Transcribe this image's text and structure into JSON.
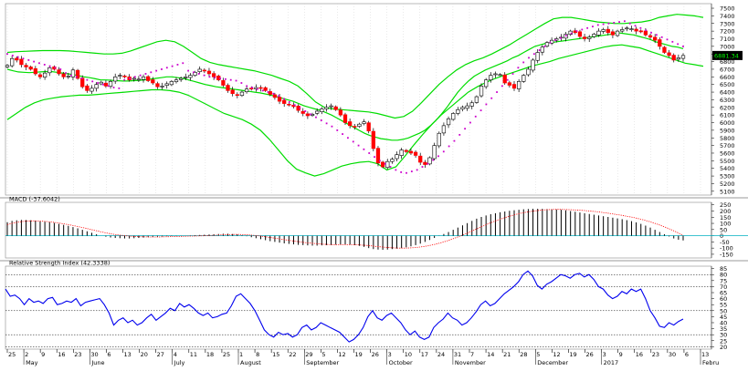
{
  "chart_data": [
    {
      "panel": "price",
      "type": "candlestick",
      "overlays": [
        "bollinger-bands",
        "parabolic-sar"
      ],
      "y_ticks": [
        5100,
        5200,
        5300,
        5400,
        5500,
        5600,
        5700,
        5800,
        5900,
        6000,
        6100,
        6200,
        6300,
        6400,
        6500,
        6600,
        6700,
        6800,
        6900,
        7000,
        7100,
        7200,
        7300,
        7400,
        7500
      ],
      "ylim": [
        5050,
        7560
      ],
      "last_price_label": "6881.34",
      "grid": "vertical-dotted",
      "colors": {
        "up": "#ffffff",
        "down": "#ff0000",
        "wick": "#000000",
        "bands": "#00dd00",
        "sar": "#cc00cc",
        "last_price_bg": "#000000",
        "last_price_fg": "#00ff00"
      },
      "close": [
        6750,
        6840,
        6820,
        6760,
        6730,
        6700,
        6640,
        6600,
        6650,
        6720,
        6700,
        6640,
        6600,
        6610,
        6690,
        6580,
        6470,
        6420,
        6450,
        6500,
        6530,
        6480,
        6540,
        6600,
        6620,
        6600,
        6560,
        6580,
        6570,
        6600,
        6550,
        6520,
        6470,
        6480,
        6510,
        6540,
        6560,
        6580,
        6600,
        6620,
        6660,
        6700,
        6680,
        6640,
        6600,
        6560,
        6490,
        6420,
        6380,
        6360,
        6400,
        6440,
        6450,
        6460,
        6450,
        6420,
        6370,
        6330,
        6280,
        6250,
        6230,
        6210,
        6160,
        6120,
        6090,
        6110,
        6150,
        6180,
        6200,
        6220,
        6170,
        6100,
        6000,
        5960,
        5950,
        5980,
        6010,
        5890,
        5660,
        5470,
        5420,
        5490,
        5520,
        5580,
        5640,
        5620,
        5600,
        5570,
        5480,
        5450,
        5540,
        5700,
        5860,
        5960,
        6050,
        6120,
        6170,
        6200,
        6220,
        6260,
        6340,
        6480,
        6560,
        6620,
        6640,
        6630,
        6520,
        6490,
        6450,
        6540,
        6620,
        6700,
        6820,
        6920,
        6990,
        7050,
        7080,
        7100,
        7120,
        7160,
        7200,
        7180,
        7130,
        7100,
        7120,
        7160,
        7200,
        7220,
        7180,
        7150,
        7200,
        7220,
        7240,
        7230,
        7200,
        7190,
        7150,
        7120,
        7080,
        7000,
        6920,
        6880,
        6820,
        6850,
        6880
      ],
      "bb_mid": [
        6700,
        6680,
        6665,
        6660,
        6655,
        6660,
        6665,
        6670,
        6670,
        6660,
        6650,
        6640,
        6630,
        6615,
        6600,
        6590,
        6575,
        6560,
        6560,
        6555,
        6550,
        6545,
        6545,
        6550,
        6555,
        6560,
        6570,
        6580,
        6590,
        6600,
        6600,
        6590,
        6580,
        6560,
        6540,
        6520,
        6500,
        6485,
        6470,
        6460,
        6450,
        6440,
        6430,
        6420,
        6410,
        6400,
        6390,
        6375,
        6360,
        6340,
        6320,
        6300,
        6280,
        6250,
        6220,
        6200,
        6180,
        6160,
        6130,
        6100,
        6060,
        6020,
        5980,
        5940,
        5900,
        5860,
        5830,
        5810,
        5790,
        5780,
        5770,
        5770,
        5780,
        5800,
        5830,
        5860,
        5900,
        5960,
        6030,
        6110,
        6200,
        6300,
        6400,
        6480,
        6550,
        6610,
        6650,
        6690,
        6720,
        6750,
        6780,
        6810,
        6850,
        6880,
        6920,
        6960,
        7000,
        7020,
        7040,
        7050,
        7060,
        7070,
        7080,
        7090,
        7100,
        7110,
        7120,
        7130,
        7140,
        7150,
        7160,
        7180,
        7170,
        7160,
        7150,
        7130,
        7110,
        7090,
        7060,
        7040,
        7020,
        7000,
        6990,
        6970
      ],
      "bb_upper": [
        6920,
        6930,
        6935,
        6940,
        6945,
        6945,
        6945,
        6940,
        6930,
        6920,
        6910,
        6900,
        6900,
        6910,
        6940,
        6980,
        7020,
        7060,
        7080,
        7060,
        7000,
        6920,
        6840,
        6790,
        6760,
        6740,
        6720,
        6700,
        6680,
        6650,
        6620,
        6580,
        6540,
        6480,
        6380,
        6270,
        6200,
        6180,
        6170,
        6160,
        6150,
        6140,
        6120,
        6090,
        6060,
        6080,
        6150,
        6260,
        6380,
        6500,
        6600,
        6690,
        6760,
        6810,
        6850,
        6900,
        6960,
        7020,
        7090,
        7160,
        7230,
        7300,
        7360,
        7380,
        7380,
        7360,
        7340,
        7320,
        7310,
        7300,
        7300,
        7310,
        7320,
        7340,
        7380,
        7400,
        7420,
        7410,
        7400,
        7380
      ],
      "bb_lower": [
        6040,
        6120,
        6200,
        6260,
        6300,
        6320,
        6340,
        6350,
        6360,
        6360,
        6370,
        6380,
        6390,
        6400,
        6410,
        6420,
        6430,
        6430,
        6420,
        6400,
        6360,
        6300,
        6240,
        6180,
        6120,
        6080,
        6040,
        5980,
        5900,
        5780,
        5640,
        5500,
        5390,
        5340,
        5300,
        5330,
        5380,
        5430,
        5460,
        5480,
        5490,
        5460,
        5380,
        5420,
        5560,
        5710,
        5850,
        5980,
        6100,
        6200,
        6300,
        6400,
        6470,
        6530,
        6580,
        6620,
        6660,
        6700,
        6740,
        6770,
        6800,
        6840,
        6870,
        6900,
        6930,
        6960,
        6990,
        7010,
        7020,
        7000,
        6980,
        6940,
        6900,
        6860,
        6820,
        6780,
        6760,
        6740
      ],
      "sar": [
        6900,
        6880,
        6860,
        6840,
        6820,
        6800,
        6780,
        6760,
        6740,
        6720,
        6700,
        6650,
        6620,
        6600,
        6580,
        6560,
        6540,
        6520,
        6500,
        6480,
        6460,
        6450,
        6560,
        6580,
        6600,
        6620,
        6640,
        6660,
        6680,
        6700,
        6720,
        6740,
        6760,
        6780,
        6680,
        6660,
        6640,
        6620,
        6600,
        6590,
        6580,
        6570,
        6560,
        6550,
        6520,
        6480,
        6460,
        6440,
        6420,
        6400,
        6380,
        6350,
        6310,
        6270,
        6230,
        6190,
        6150,
        6110,
        6070,
        6030,
        5990,
        5950,
        5900,
        5850,
        5800,
        5750,
        5700,
        5650,
        5600,
        5550,
        5500,
        5460,
        5420,
        5380,
        5350,
        5340,
        5360,
        5380,
        5420,
        5460,
        5510,
        5560,
        5620,
        5690,
        5760,
        5840,
        5920,
        6000,
        6080,
        6160,
        6240,
        6320,
        6400,
        6480,
        6560,
        6640,
        6720,
        6790,
        6850,
        6900,
        6950,
        7000,
        7050,
        7080,
        7110,
        7140,
        7170,
        7200,
        7220,
        7240,
        7260,
        7280,
        7290,
        7300,
        7310,
        7320,
        7330,
        7300,
        7270,
        7240,
        7210,
        7180,
        7150,
        7120,
        7090,
        7060,
        7030,
        7000
      ]
    },
    {
      "panel": "macd",
      "type": "histogram",
      "title": "MACD (-37.6042)",
      "y_ticks": [
        250,
        200,
        150,
        100,
        50,
        0,
        -50,
        -100,
        -150
      ],
      "ylim": [
        -180,
        270
      ],
      "colors": {
        "hist": "#000000",
        "signal": "#ff0000",
        "zero": "#00b0c0"
      },
      "histogram": [
        110,
        120,
        125,
        128,
        127,
        125,
        122,
        118,
        114,
        110,
        104,
        96,
        88,
        80,
        70,
        60,
        48,
        36,
        24,
        12,
        0,
        -8,
        -14,
        -18,
        -20,
        -22,
        -22,
        -20,
        -18,
        -15,
        -12,
        -10,
        -8,
        -6,
        -4,
        -3,
        -2,
        -1,
        0,
        2,
        4,
        6,
        8,
        10,
        12,
        14,
        16,
        16,
        14,
        10,
        4,
        -4,
        -12,
        -20,
        -28,
        -36,
        -44,
        -50,
        -56,
        -62,
        -66,
        -70,
        -74,
        -76,
        -78,
        -80,
        -80,
        -78,
        -76,
        -74,
        -72,
        -70,
        -70,
        -72,
        -76,
        -82,
        -90,
        -100,
        -108,
        -112,
        -114,
        -112,
        -108,
        -104,
        -100,
        -94,
        -86,
        -76,
        -64,
        -50,
        -34,
        -18,
        -2,
        14,
        30,
        48,
        66,
        84,
        102,
        120,
        138,
        152,
        164,
        174,
        182,
        190,
        196,
        202,
        206,
        210,
        214,
        216,
        218,
        218,
        218,
        216,
        214,
        212,
        210,
        206,
        200,
        194,
        188,
        182,
        176,
        170,
        164,
        158,
        152,
        146,
        140,
        134,
        126,
        118,
        108,
        96,
        82,
        66,
        48,
        30,
        12,
        -6,
        -22,
        -32,
        -38
      ],
      "signal": [
        90,
        100,
        108,
        114,
        118,
        120,
        120,
        118,
        116,
        112,
        108,
        102,
        96,
        89,
        82,
        74,
        66,
        57,
        48,
        39,
        30,
        22,
        15,
        9,
        4,
        0,
        -4,
        -6,
        -8,
        -9,
        -10,
        -10,
        -10,
        -9,
        -8,
        -7,
        -6,
        -5,
        -4,
        -3,
        -2,
        -1,
        0,
        2,
        4,
        6,
        8,
        9,
        10,
        10,
        9,
        7,
        4,
        0,
        -5,
        -10,
        -16,
        -22,
        -28,
        -34,
        -40,
        -45,
        -50,
        -55,
        -59,
        -63,
        -66,
        -69,
        -71,
        -72,
        -73,
        -73,
        -73,
        -73,
        -74,
        -76,
        -78,
        -82,
        -86,
        -90,
        -94,
        -97,
        -99,
        -100,
        -100,
        -99,
        -97,
        -93,
        -88,
        -82,
        -74,
        -65,
        -54,
        -42,
        -29,
        -15,
        0,
        16,
        33,
        50,
        67,
        84,
        100,
        116,
        130,
        143,
        155,
        166,
        176,
        185,
        192,
        198,
        203,
        207,
        210,
        212,
        213,
        213,
        212,
        211,
        209,
        207,
        204,
        201,
        197,
        193,
        188,
        183,
        177,
        171,
        165,
        158,
        151,
        143,
        134,
        124,
        113,
        100,
        87,
        72,
        57,
        40,
        22,
        4
      ],
      "zero_line": 0
    },
    {
      "panel": "rsi",
      "type": "line",
      "title": "Relative Strength Index (42.3338)",
      "y_ticks": [
        85,
        80,
        75,
        70,
        65,
        60,
        55,
        50,
        45,
        40,
        35,
        30,
        25,
        20
      ],
      "ylim": [
        18,
        87
      ],
      "reference_levels": [
        80,
        70,
        50,
        30,
        20
      ],
      "colors": {
        "line": "#0000ee",
        "reference": "#000000"
      },
      "values": [
        68,
        62,
        63,
        60,
        55,
        60,
        57,
        58,
        56,
        60,
        61,
        55,
        56,
        58,
        57,
        60,
        54,
        57,
        58,
        59,
        60,
        55,
        48,
        38,
        42,
        44,
        40,
        42,
        38,
        40,
        44,
        47,
        42,
        45,
        48,
        52,
        50,
        56,
        53,
        55,
        52,
        48,
        46,
        48,
        44,
        45,
        47,
        48,
        54,
        62,
        64,
        60,
        56,
        50,
        42,
        34,
        30,
        28,
        32,
        30,
        31,
        28,
        30,
        36,
        38,
        34,
        36,
        40,
        38,
        36,
        34,
        32,
        28,
        24,
        26,
        30,
        36,
        45,
        50,
        44,
        42,
        46,
        48,
        44,
        40,
        34,
        30,
        33,
        28,
        26,
        28,
        36,
        40,
        43,
        48,
        44,
        42,
        38,
        40,
        44,
        49,
        55,
        58,
        54,
        56,
        60,
        64,
        67,
        70,
        74,
        80,
        83,
        79,
        71,
        68,
        72,
        74,
        77,
        80,
        79,
        77,
        80,
        81,
        78,
        80,
        76,
        70,
        68,
        63,
        60,
        62,
        66,
        64,
        68,
        66,
        68,
        60,
        50,
        44,
        37,
        36,
        40,
        38,
        41,
        43
      ],
      "x_tick_labels": [
        "25",
        "2",
        "9",
        "16",
        "23",
        "30",
        "6",
        "13",
        "20",
        "27",
        "4",
        "11",
        "18",
        "25",
        "1",
        "8",
        "15",
        "22",
        "29",
        "5",
        "12",
        "19",
        "26",
        "3",
        "10",
        "17",
        "24",
        "31",
        "7",
        "14",
        "21",
        "28",
        "5",
        "12",
        "19",
        "26",
        "3",
        "9",
        "16",
        "23",
        "30",
        "6",
        "13"
      ],
      "x_month_labels": [
        "May",
        "June",
        "July",
        "August",
        "September",
        "October",
        "November",
        "December",
        "2017",
        "Febru"
      ]
    }
  ]
}
